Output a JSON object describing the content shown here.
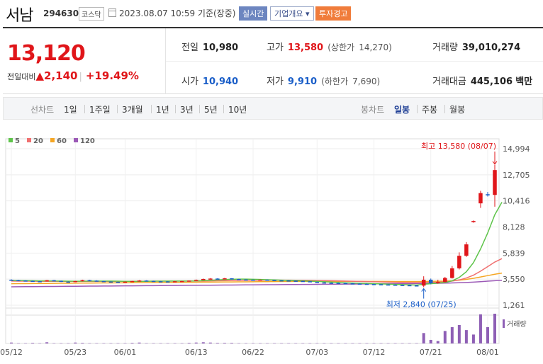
{
  "stock": {
    "name": "서남",
    "code": "294630",
    "market": "코스닥",
    "timestamp": "2023.08.07 10:59  기준(장중)",
    "btn_realtime": "실시간",
    "btn_company": "기업개요 ▾",
    "btn_warning": "투자경고"
  },
  "quote": {
    "current_price": "13,120",
    "change_label": "전일대비",
    "change_arrow": "▲",
    "change_value": "2,140",
    "change_rate": "+19.49%",
    "prev_close_label": "전일",
    "prev_close": "10,980",
    "high_label": "고가",
    "high": "13,580",
    "upper_limit_label": "(상한가",
    "upper_limit": "14,270)",
    "volume_label": "거래량",
    "volume": "39,010,274",
    "open_label": "시가",
    "open": "10,940",
    "low_label": "저가",
    "low": "9,910",
    "lower_limit_label": "(하한가",
    "lower_limit": "7,690)",
    "trade_amount_label": "거래대금",
    "trade_amount": "445,106",
    "trade_amount_unit": "백만"
  },
  "period_bar": {
    "line_chart": "선차트",
    "periods": [
      "1일",
      "1주일",
      "3개월",
      "1년",
      "3년",
      "5년",
      "10년"
    ],
    "candle_chart": "봉차트",
    "candle_types": [
      "일봉",
      "주봉",
      "월봉"
    ],
    "active_candle": "일봉"
  },
  "colors": {
    "up": "#e0161a",
    "down": "#1a5ec8",
    "ma5": "#5ec44a",
    "ma20": "#f07070",
    "ma60": "#f5a623",
    "ma120": "#9b59b6",
    "volume": "#8e5fb5"
  },
  "chart_data": {
    "type": "candlestick",
    "legend": [
      {
        "name": "5",
        "color": "#5ec44a"
      },
      {
        "name": "20",
        "color": "#f07070"
      },
      {
        "name": "60",
        "color": "#f5a623"
      },
      {
        "name": "120",
        "color": "#9b59b6"
      }
    ],
    "y_ticks": [
      "14,994",
      "12,705",
      "10,416",
      "8,128",
      "5,839",
      "3,550",
      "1,261"
    ],
    "ylim": [
      1261,
      14994
    ],
    "x_ticks": [
      "05/12",
      "05/23",
      "06/01",
      "06/13",
      "06/22",
      "07/03",
      "07/12",
      "07/21",
      "08/01"
    ],
    "high_annotation": "최고 13,580 (08/07)",
    "low_annotation": "최저 2,840 (07/25)",
    "volume_label": "거래량",
    "candles": [
      {
        "o": 3500,
        "c": 3460,
        "h": 3540,
        "l": 3420
      },
      {
        "o": 3460,
        "c": 3430,
        "h": 3490,
        "l": 3390
      },
      {
        "o": 3430,
        "c": 3400,
        "h": 3460,
        "l": 3370
      },
      {
        "o": 3400,
        "c": 3370,
        "h": 3430,
        "l": 3340
      },
      {
        "o": 3370,
        "c": 3360,
        "h": 3400,
        "l": 3320
      },
      {
        "o": 3360,
        "c": 3450,
        "h": 3480,
        "l": 3340
      },
      {
        "o": 3450,
        "c": 3400,
        "h": 3480,
        "l": 3370
      },
      {
        "o": 3400,
        "c": 3330,
        "h": 3420,
        "l": 3300
      },
      {
        "o": 3330,
        "c": 3300,
        "h": 3360,
        "l": 3270
      },
      {
        "o": 3300,
        "c": 3380,
        "h": 3400,
        "l": 3280
      },
      {
        "o": 3380,
        "c": 3460,
        "h": 3500,
        "l": 3360
      },
      {
        "o": 3460,
        "c": 3420,
        "h": 3490,
        "l": 3390
      },
      {
        "o": 3420,
        "c": 3380,
        "h": 3450,
        "l": 3350
      },
      {
        "o": 3380,
        "c": 3340,
        "h": 3400,
        "l": 3310
      },
      {
        "o": 3340,
        "c": 3310,
        "h": 3370,
        "l": 3280
      },
      {
        "o": 3310,
        "c": 3290,
        "h": 3340,
        "l": 3260
      },
      {
        "o": 3290,
        "c": 3330,
        "h": 3350,
        "l": 3270
      },
      {
        "o": 3330,
        "c": 3380,
        "h": 3400,
        "l": 3310
      },
      {
        "o": 3380,
        "c": 3430,
        "h": 3460,
        "l": 3360
      },
      {
        "o": 3430,
        "c": 3390,
        "h": 3450,
        "l": 3360
      },
      {
        "o": 3390,
        "c": 3360,
        "h": 3410,
        "l": 3330
      },
      {
        "o": 3360,
        "c": 3350,
        "h": 3390,
        "l": 3320
      },
      {
        "o": 3350,
        "c": 3330,
        "h": 3370,
        "l": 3300
      },
      {
        "o": 3330,
        "c": 3360,
        "h": 3380,
        "l": 3310
      },
      {
        "o": 3360,
        "c": 3380,
        "h": 3400,
        "l": 3340
      },
      {
        "o": 3380,
        "c": 3420,
        "h": 3440,
        "l": 3360
      },
      {
        "o": 3420,
        "c": 3480,
        "h": 3520,
        "l": 3400
      },
      {
        "o": 3480,
        "c": 3560,
        "h": 3600,
        "l": 3460
      },
      {
        "o": 3560,
        "c": 3600,
        "h": 3640,
        "l": 3520
      },
      {
        "o": 3600,
        "c": 3580,
        "h": 3630,
        "l": 3550
      },
      {
        "o": 3580,
        "c": 3620,
        "h": 3660,
        "l": 3560
      },
      {
        "o": 3620,
        "c": 3560,
        "h": 3640,
        "l": 3520
      },
      {
        "o": 3560,
        "c": 3520,
        "h": 3580,
        "l": 3490
      },
      {
        "o": 3520,
        "c": 3500,
        "h": 3540,
        "l": 3470
      },
      {
        "o": 3500,
        "c": 3480,
        "h": 3520,
        "l": 3450
      },
      {
        "o": 3480,
        "c": 3500,
        "h": 3520,
        "l": 3460
      },
      {
        "o": 3500,
        "c": 3470,
        "h": 3520,
        "l": 3450
      },
      {
        "o": 3470,
        "c": 3440,
        "h": 3490,
        "l": 3420
      },
      {
        "o": 3440,
        "c": 3430,
        "h": 3460,
        "l": 3410
      },
      {
        "o": 3430,
        "c": 3410,
        "h": 3450,
        "l": 3390
      },
      {
        "o": 3410,
        "c": 3390,
        "h": 3430,
        "l": 3370
      },
      {
        "o": 3390,
        "c": 3360,
        "h": 3410,
        "l": 3340
      },
      {
        "o": 3360,
        "c": 3310,
        "h": 3380,
        "l": 3290
      },
      {
        "o": 3310,
        "c": 3260,
        "h": 3330,
        "l": 3240
      },
      {
        "o": 3260,
        "c": 3230,
        "h": 3280,
        "l": 3200
      },
      {
        "o": 3230,
        "c": 3210,
        "h": 3250,
        "l": 3180
      },
      {
        "o": 3210,
        "c": 3200,
        "h": 3240,
        "l": 3170
      },
      {
        "o": 3200,
        "c": 3180,
        "h": 3220,
        "l": 3150
      },
      {
        "o": 3180,
        "c": 3160,
        "h": 3200,
        "l": 3130
      },
      {
        "o": 3160,
        "c": 3140,
        "h": 3180,
        "l": 3110
      },
      {
        "o": 3140,
        "c": 3120,
        "h": 3170,
        "l": 3090
      },
      {
        "o": 3120,
        "c": 3100,
        "h": 3150,
        "l": 3070
      },
      {
        "o": 3100,
        "c": 3080,
        "h": 3130,
        "l": 3050
      },
      {
        "o": 3080,
        "c": 3060,
        "h": 3110,
        "l": 3030
      },
      {
        "o": 3060,
        "c": 3040,
        "h": 3090,
        "l": 3010
      },
      {
        "o": 3040,
        "c": 3020,
        "h": 3070,
        "l": 2990
      },
      {
        "o": 3020,
        "c": 3000,
        "h": 3050,
        "l": 2970
      },
      {
        "o": 3000,
        "c": 2980,
        "h": 3030,
        "l": 2950
      },
      {
        "o": 2980,
        "c": 3500,
        "h": 3800,
        "l": 2840
      },
      {
        "o": 3500,
        "c": 3200,
        "h": 3600,
        "l": 3100
      },
      {
        "o": 3200,
        "c": 3300,
        "h": 3500,
        "l": 3150
      },
      {
        "o": 3300,
        "c": 3650,
        "h": 3750,
        "l": 3250
      },
      {
        "o": 3650,
        "c": 4500,
        "h": 4700,
        "l": 3600
      },
      {
        "o": 4500,
        "c": 5600,
        "h": 5900,
        "l": 4400
      },
      {
        "o": 5600,
        "c": 6600,
        "h": 6800,
        "l": 5500
      },
      {
        "o": 8600,
        "c": 8650,
        "h": 8700,
        "l": 8500
      },
      {
        "o": 10200,
        "c": 11100,
        "h": 11300,
        "l": 9800
      },
      {
        "o": 11000,
        "c": 10900,
        "h": 11200,
        "l": 10800
      },
      {
        "o": 10940,
        "c": 13120,
        "h": 13580,
        "l": 9910
      }
    ],
    "ma5": [
      3440,
      3430,
      3420,
      3410,
      3400,
      3395,
      3390,
      3380,
      3370,
      3365,
      3370,
      3380,
      3385,
      3385,
      3380,
      3370,
      3360,
      3350,
      3350,
      3360,
      3370,
      3375,
      3380,
      3380,
      3380,
      3385,
      3400,
      3420,
      3450,
      3480,
      3510,
      3540,
      3550,
      3550,
      3540,
      3520,
      3500,
      3480,
      3460,
      3440,
      3420,
      3400,
      3375,
      3350,
      3320,
      3290,
      3260,
      3230,
      3210,
      3190,
      3170,
      3150,
      3130,
      3110,
      3090,
      3070,
      3050,
      3030,
      3100,
      3150,
      3200,
      3250,
      3400,
      3700,
      4200,
      5000,
      6200,
      7600,
      9200,
      10300
    ],
    "ma20": [
      3380,
      3375,
      3370,
      3365,
      3360,
      3358,
      3356,
      3354,
      3352,
      3350,
      3350,
      3352,
      3354,
      3356,
      3358,
      3360,
      3362,
      3364,
      3366,
      3368,
      3370,
      3372,
      3374,
      3376,
      3378,
      3380,
      3385,
      3390,
      3400,
      3410,
      3420,
      3430,
      3440,
      3445,
      3450,
      3455,
      3458,
      3460,
      3460,
      3458,
      3455,
      3450,
      3440,
      3430,
      3420,
      3410,
      3395,
      3380,
      3365,
      3350,
      3335,
      3320,
      3305,
      3290,
      3275,
      3260,
      3250,
      3240,
      3250,
      3260,
      3280,
      3310,
      3380,
      3480,
      3650,
      3900,
      4250,
      4650,
      5050,
      5350
    ],
    "ma60": [
      3150,
      3155,
      3160,
      3165,
      3170,
      3175,
      3180,
      3185,
      3190,
      3195,
      3200,
      3205,
      3210,
      3215,
      3220,
      3225,
      3230,
      3235,
      3240,
      3245,
      3250,
      3255,
      3260,
      3265,
      3270,
      3275,
      3280,
      3285,
      3290,
      3295,
      3300,
      3305,
      3310,
      3315,
      3320,
      3325,
      3330,
      3335,
      3340,
      3345,
      3350,
      3352,
      3354,
      3356,
      3358,
      3360,
      3360,
      3360,
      3358,
      3356,
      3354,
      3352,
      3350,
      3348,
      3346,
      3344,
      3342,
      3340,
      3345,
      3355,
      3365,
      3380,
      3410,
      3460,
      3530,
      3620,
      3740,
      3860,
      3980,
      4080
    ],
    "ma120": [
      2880,
      2885,
      2890,
      2895,
      2900,
      2905,
      2910,
      2915,
      2920,
      2925,
      2930,
      2935,
      2940,
      2945,
      2950,
      2955,
      2960,
      2965,
      2970,
      2975,
      2980,
      2985,
      2990,
      2995,
      3000,
      3005,
      3010,
      3015,
      3020,
      3025,
      3030,
      3035,
      3040,
      3045,
      3050,
      3055,
      3060,
      3065,
      3070,
      3075,
      3080,
      3085,
      3090,
      3095,
      3100,
      3105,
      3110,
      3115,
      3120,
      3125,
      3130,
      3135,
      3140,
      3145,
      3150,
      3155,
      3160,
      3165,
      3170,
      3180,
      3190,
      3200,
      3215,
      3235,
      3260,
      3290,
      3330,
      3370,
      3410,
      3450
    ],
    "volume_relative": [
      0.03,
      0.01,
      0.01,
      0.02,
      0.01,
      0.04,
      0.01,
      0.01,
      0.01,
      0.03,
      0.02,
      0.01,
      0.01,
      0.01,
      0.01,
      0.01,
      0.01,
      0.02,
      0.03,
      0.01,
      0.01,
      0.01,
      0.01,
      0.01,
      0.01,
      0.02,
      0.03,
      0.04,
      0.03,
      0.02,
      0.02,
      0.02,
      0.01,
      0.01,
      0.01,
      0.01,
      0.01,
      0.01,
      0.01,
      0.01,
      0.01,
      0.01,
      0.01,
      0.01,
      0.01,
      0.01,
      0.01,
      0.01,
      0.01,
      0.01,
      0.01,
      0.01,
      0.01,
      0.01,
      0.01,
      0.01,
      0.01,
      0.01,
      0.35,
      0.12,
      0.08,
      0.42,
      0.55,
      0.62,
      0.45,
      0.3,
      0.98,
      0.55,
      1.0
    ]
  }
}
